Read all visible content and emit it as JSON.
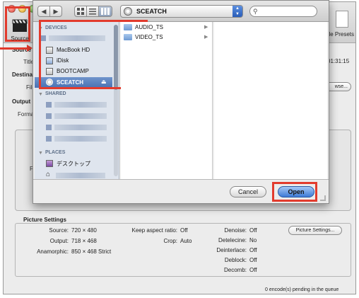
{
  "background": {
    "toolbar": {
      "source_label": "Source",
      "presets_label": "gle Presets"
    },
    "source_section": {
      "source_label": "Source",
      "title_label": "Title",
      "title_time": "01:31:15",
      "destination_label": "Destinat",
      "file_label": "File",
      "browse_button": "wse...",
      "output_label": "Output",
      "format_label": "Format",
      "fr_label": "Fr"
    },
    "picture_settings": {
      "title": "Picture Settings",
      "source_label": "Source:",
      "source_value": "720 × 480",
      "output_label": "Output:",
      "output_value": "718 × 468",
      "anamorphic_label": "Anamorphic:",
      "anamorphic_value": "850 × 468 Strict",
      "keep_aspect_label": "Keep aspect ratio:",
      "keep_aspect_value": "Off",
      "crop_label": "Crop:",
      "crop_value": "Auto",
      "denoise_label": "Denoise:",
      "denoise_value": "Off",
      "detelecine_label": "Detelecine:",
      "detelecine_value": "No",
      "deinterlace_label": "Deinterlace:",
      "deinterlace_value": "Off",
      "deblock_label": "Deblock:",
      "deblock_value": "Off",
      "decomb_label": "Decomb:",
      "decomb_value": "Off",
      "button_label": "Picture Settings..."
    },
    "queue_status": "0 encode(s) pending in the queue"
  },
  "dialog": {
    "back_icon": "◀",
    "forward_icon": "▶",
    "location": "SCEATCH",
    "search_placeholder": "",
    "sidebar": {
      "devices_header": "DEVICES",
      "devices": [
        {
          "label": "MacBook HD",
          "icon": "hard-drive-icon"
        },
        {
          "label": "iDisk",
          "icon": "idisk-icon"
        },
        {
          "label": "BOOTCAMP",
          "icon": "hard-drive-icon"
        },
        {
          "label": "SCEATCH",
          "icon": "disc-icon",
          "selected": true
        }
      ],
      "shared_header": "SHARED",
      "places_header": "PLACES",
      "places": [
        {
          "label": "デスクトップ",
          "icon": "desktop-icon"
        }
      ]
    },
    "files": [
      {
        "name": "AUDIO_TS",
        "icon": "folder-icon"
      },
      {
        "name": "VIDEO_TS",
        "icon": "folder-icon"
      }
    ],
    "cancel_button": "Cancel",
    "open_button": "Open"
  }
}
